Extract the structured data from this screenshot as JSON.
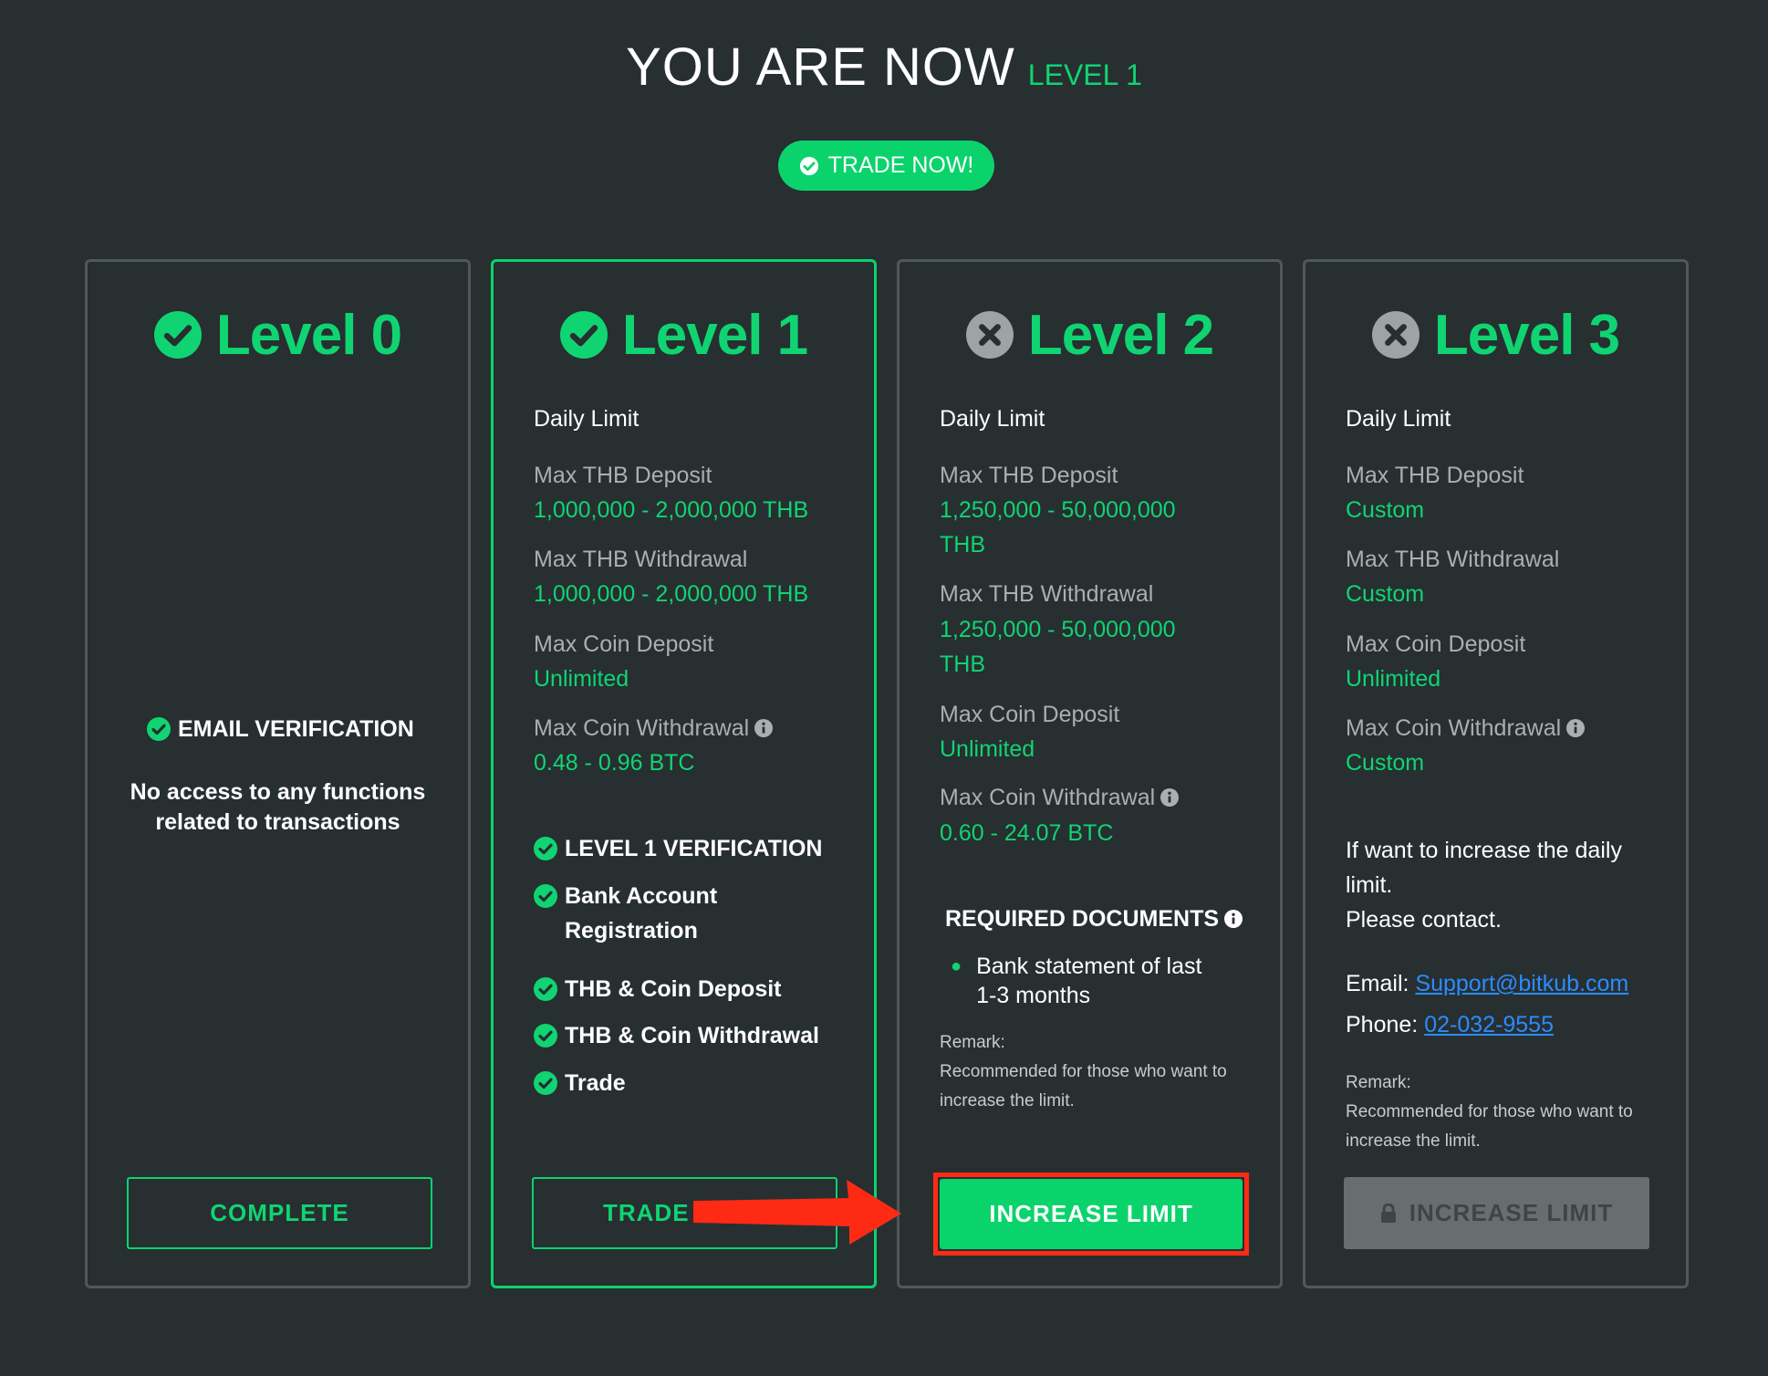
{
  "header": {
    "title": "YOU ARE NOW",
    "current_level": "LEVEL 1",
    "trade_button": "TRADE NOW!"
  },
  "levels": [
    {
      "name": "Level 0",
      "status": "check",
      "verification": "EMAIL VERIFICATION",
      "description": "No access to any functions related to transactions",
      "button": "COMPLETE"
    },
    {
      "name": "Level 1",
      "status": "check",
      "daily_limit": "Daily Limit",
      "thb_deposit_label": "Max THB Deposit",
      "thb_deposit_value": "1,000,000 - 2,000,000 THB",
      "thb_withdrawal_label": "Max THB Withdrawal",
      "thb_withdrawal_value": "1,000,000 - 2,000,000 THB",
      "coin_deposit_label": "Max Coin Deposit",
      "coin_deposit_value": "Unlimited",
      "coin_withdrawal_label": "Max Coin Withdrawal",
      "coin_withdrawal_value": "0.48 - 0.96 BTC",
      "verification": "LEVEL 1 VERIFICATION",
      "features": [
        "Bank Account Registration",
        "THB & Coin Deposit",
        "THB & Coin Withdrawal",
        "Trade"
      ],
      "button": "TRADE NOW!"
    },
    {
      "name": "Level 2",
      "status": "cross",
      "daily_limit": "Daily Limit",
      "thb_deposit_label": "Max THB Deposit",
      "thb_deposit_value": "1,250,000 - 50,000,000 THB",
      "thb_withdrawal_label": "Max THB Withdrawal",
      "thb_withdrawal_value": "1,250,000 - 50,000,000 THB",
      "coin_deposit_label": "Max Coin Deposit",
      "coin_deposit_value": "Unlimited",
      "coin_withdrawal_label": "Max Coin Withdrawal",
      "coin_withdrawal_value": "0.60 - 24.07 BTC",
      "required_docs_label": "REQUIRED DOCUMENTS",
      "required_docs": [
        "Bank statement of last 1-3 months"
      ],
      "remark_label": "Remark:",
      "remark": "Recommended for those who want to increase the limit.",
      "button": "INCREASE LIMIT"
    },
    {
      "name": "Level 3",
      "status": "cross",
      "daily_limit": "Daily Limit",
      "thb_deposit_label": "Max THB Deposit",
      "thb_deposit_value": "Custom",
      "thb_withdrawal_label": "Max THB Withdrawal",
      "thb_withdrawal_value": "Custom",
      "coin_deposit_label": "Max Coin Deposit",
      "coin_deposit_value": "Unlimited",
      "coin_withdrawal_label": "Max Coin Withdrawal",
      "coin_withdrawal_value": "Custom",
      "contact_text": "If want to increase the daily limit.",
      "contact_text2": "Please contact.",
      "email_label": "Email:",
      "email": "Support@bitkub.com",
      "phone_label": "Phone:",
      "phone": "02-032-9555",
      "remark_label": "Remark:",
      "remark": "Recommended for those who want to increase the limit.",
      "button": "INCREASE LIMIT"
    }
  ],
  "colors": {
    "background": "#272f31",
    "accent_green": "#10d472",
    "button_green": "#0bd36c",
    "border_grey": "#51585a",
    "annotation_red": "#ff2a14",
    "link_blue": "#2b8cff"
  }
}
